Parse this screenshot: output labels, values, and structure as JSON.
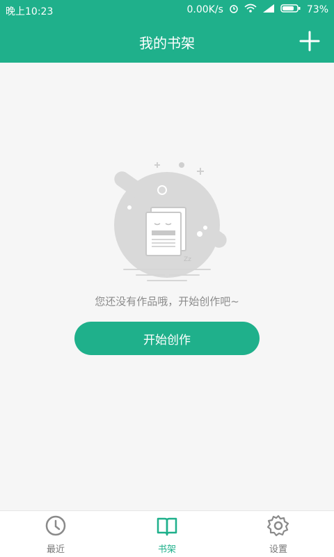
{
  "status": {
    "time": "晚上10:23",
    "net_speed": "0.00K/s",
    "battery": "73%"
  },
  "header": {
    "title": "我的书架",
    "add_icon": "plus-icon"
  },
  "empty_state": {
    "message": "您还没有作品哦，开始创作吧~",
    "button_label": "开始创作"
  },
  "tabs": [
    {
      "label": "最近",
      "icon": "clock-icon",
      "active": false
    },
    {
      "label": "书架",
      "icon": "book-icon",
      "active": true
    },
    {
      "label": "设置",
      "icon": "gear-icon",
      "active": false
    }
  ],
  "colors": {
    "accent": "#1fb08b",
    "background": "#f6f6f6",
    "muted_text": "#8b8b8b"
  }
}
